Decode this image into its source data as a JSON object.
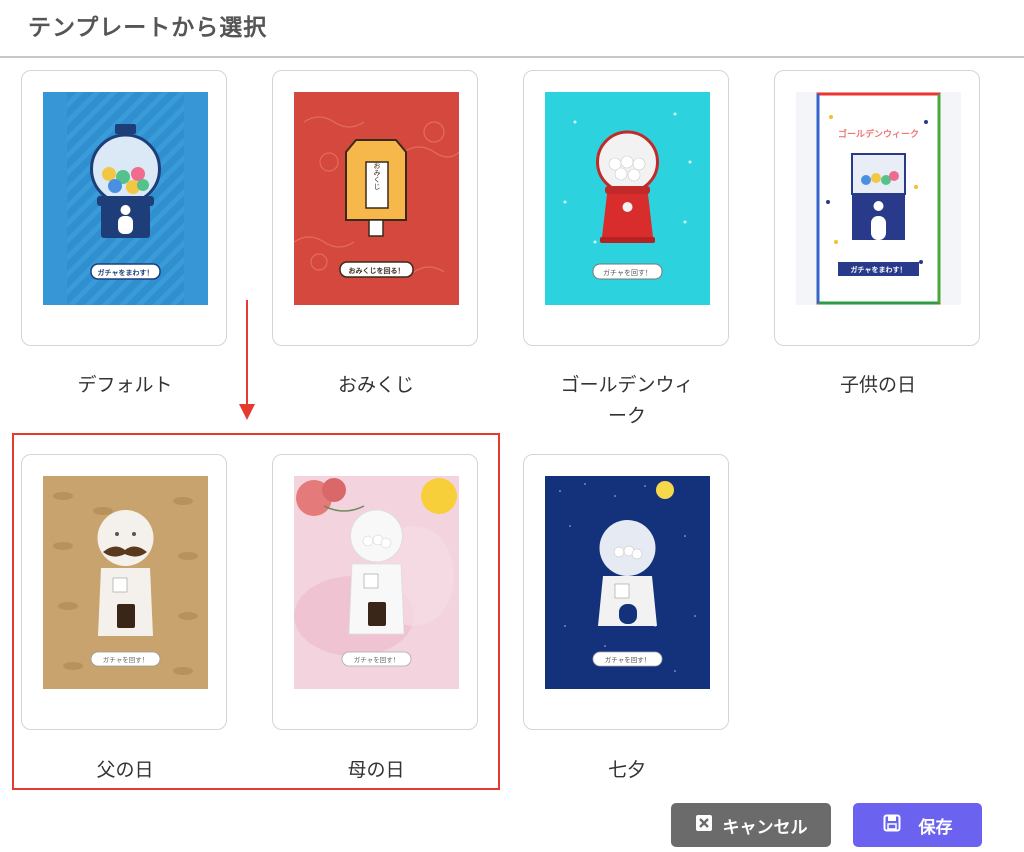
{
  "header": {
    "title": "テンプレートから選択"
  },
  "templates": [
    {
      "label": "デフォルト",
      "thumb_button": "ガチャをまわす！"
    },
    {
      "label": "おみくじ",
      "thumb_button": "おみくじを回る！",
      "thumb_text": "おみくじ"
    },
    {
      "label": "ゴールデンウィ\nーク",
      "thumb_button": "ガチャを回す！"
    },
    {
      "label": "子供の日",
      "thumb_title": "ゴールデンウィーク",
      "thumb_button": "ガチャをまわす！"
    },
    {
      "label": "父の日",
      "thumb_button": "ガチャを回す！"
    },
    {
      "label": "母の日",
      "thumb_button": "ガチャを回す！"
    },
    {
      "label": "七夕",
      "thumb_button": "ガチャを回す！"
    }
  ],
  "actions": {
    "cancel": "キャンセル",
    "save": "保存"
  },
  "colors": {
    "highlight": "#e63a2e",
    "save_bg": "#6b63f0",
    "cancel_bg": "#6b6b6b"
  }
}
